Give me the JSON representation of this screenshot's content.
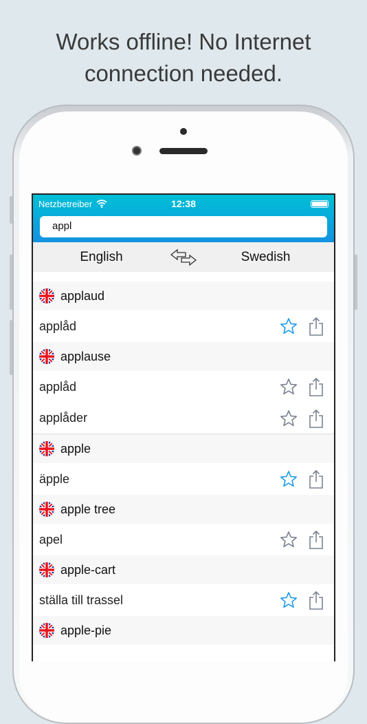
{
  "headline": [
    "Works offline! No Internet",
    "connection needed."
  ],
  "status": {
    "carrier": "Netzbetreiber",
    "time": "12:38"
  },
  "search": {
    "value": "appl"
  },
  "languages": {
    "from": "English",
    "to": "Swedish"
  },
  "colors": {
    "accent": "#1e9be8",
    "star_inactive": "#7a8190",
    "bar_top": "#00c0d6",
    "bar_bottom": "#1392e0"
  },
  "entries": [
    {
      "word": "applaud",
      "translations": [
        {
          "text": "applåd",
          "favorite": true
        }
      ]
    },
    {
      "word": "applause",
      "translations": [
        {
          "text": "applåd",
          "favorite": false
        },
        {
          "text": "applåder",
          "favorite": false
        }
      ]
    },
    {
      "word": "apple",
      "translations": [
        {
          "text": "äpple",
          "favorite": true
        }
      ]
    },
    {
      "word": "apple tree",
      "translations": [
        {
          "text": "apel",
          "favorite": false
        }
      ]
    },
    {
      "word": "apple-cart",
      "translations": [
        {
          "text": "ställa till trassel",
          "favorite": true
        }
      ]
    },
    {
      "word": "apple-pie",
      "translations": []
    }
  ]
}
